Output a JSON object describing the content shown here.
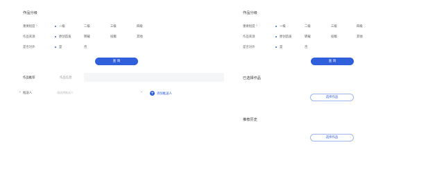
{
  "left": {
    "section_title": "作品分级",
    "level_label": "重要程度",
    "level_options": [
      "一级",
      "二级",
      "三级",
      "四级"
    ],
    "source_label": "作品来源",
    "source_options": [
      "原创首发",
      "转载",
      "投稿",
      "其他"
    ],
    "public_label": "是否对外",
    "public_options": [
      "是",
      "否"
    ],
    "search_button": "查 询",
    "tab_recommended": "作品推荐",
    "tab_other": "作品信息",
    "reviewer_label": "推送人",
    "reviewer_placeholder": "请选择推送人",
    "chevron": "⌄",
    "add_reviewer": "添加推送人"
  },
  "right": {
    "section_title": "作品分级",
    "level_label": "重要程度",
    "level_options": [
      "一级",
      "二级",
      "三级",
      "四级"
    ],
    "source_label": "作品来源",
    "source_options": [
      "原创首发",
      "转载",
      "投稿",
      "其他"
    ],
    "public_label": "是否对外",
    "public_options": [
      "是",
      "否"
    ],
    "search_button": "查 询",
    "section_selected": "已选择作品",
    "select_button_1": "选择作品",
    "section_history": "推荐历史",
    "select_button_2": "选择作品"
  }
}
